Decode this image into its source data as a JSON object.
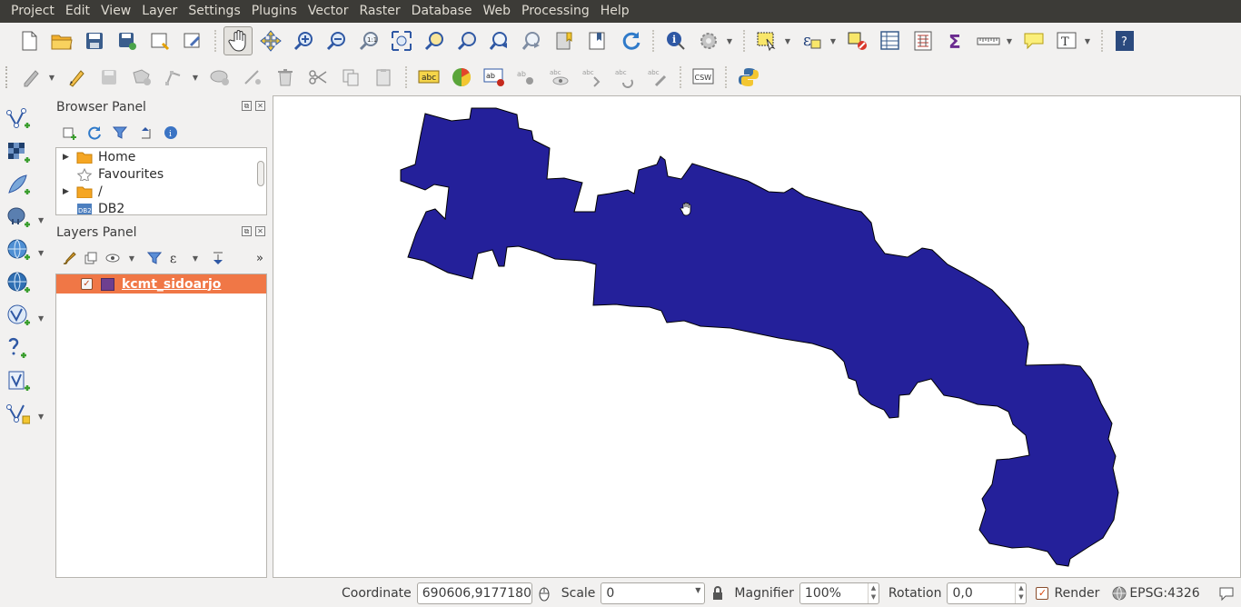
{
  "menu": [
    "Project",
    "Edit",
    "View",
    "Layer",
    "Settings",
    "Plugins",
    "Vector",
    "Raster",
    "Database",
    "Web",
    "Processing",
    "Help"
  ],
  "browser_panel": {
    "title": "Browser Panel",
    "items": [
      {
        "label": "Home",
        "icon": "folder-icon",
        "expandable": true
      },
      {
        "label": "Favourites",
        "icon": "star-icon",
        "expandable": false
      },
      {
        "label": "/",
        "icon": "folder-icon",
        "expandable": true
      },
      {
        "label": "DB2",
        "icon": "db2-icon",
        "expandable": false,
        "icon_text": "DB2"
      }
    ]
  },
  "layers_panel": {
    "title": "Layers Panel",
    "layers": [
      {
        "name": "kcmt_sidoarjo",
        "checked": true,
        "color": "#6e3f8f"
      }
    ]
  },
  "map": {
    "feature_fill": "#24209a",
    "feature_stroke": "#000000",
    "cursor": "pan-hand"
  },
  "toolbar2": {
    "csw_label": "CSW",
    "abc_label": "abc",
    "ab_label": "ab"
  },
  "statusbar": {
    "coordinate_label": "Coordinate",
    "coordinate_value": "690606,9177180",
    "scale_label": "Scale",
    "scale_value": "0",
    "magnifier_label": "Magnifier",
    "magnifier_value": "100%",
    "rotation_label": "Rotation",
    "rotation_value": "0,0",
    "render_label": "Render",
    "render_checked": true,
    "crs_label": "EPSG:4326"
  },
  "colors": {
    "menubar": "#3c3b37",
    "selected_layer": "#f07746",
    "accent": "#e05a2a"
  }
}
